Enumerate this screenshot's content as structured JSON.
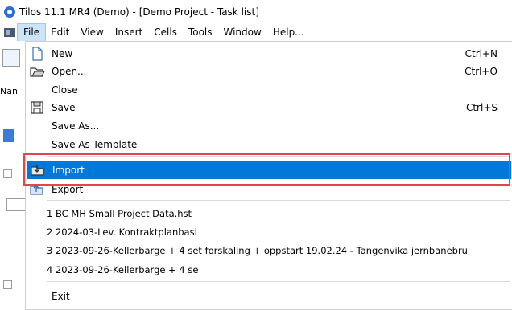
{
  "window": {
    "title": "Tilos 11.1 MR4  (Demo) - [Demo Project -  Task list]"
  },
  "menubar": {
    "items": [
      "File",
      "Edit",
      "View",
      "Insert",
      "Cells",
      "Tools",
      "Window",
      "Help..."
    ]
  },
  "background": {
    "partial_label": "Nan"
  },
  "file_menu": {
    "new": {
      "label": "New",
      "shortcut": "Ctrl+N"
    },
    "open": {
      "label": "Open...",
      "shortcut": "Ctrl+O"
    },
    "close": {
      "label": "Close"
    },
    "save": {
      "label": "Save",
      "shortcut": "Ctrl+S"
    },
    "save_as": {
      "label": "Save As..."
    },
    "save_as_template": {
      "label": "Save As Template"
    },
    "import": {
      "label": "Import"
    },
    "export": {
      "label": "Export"
    },
    "recent": [
      "1 BC MH Small Project Data.hst",
      "2 2024-03-Lev. Kontraktplanbasi",
      "3 2023-09-26-Kellerbarge + 4 set forskaling + oppstart 19.02.24 - Tangenvika jernbanebru",
      "4 2023-09-26-Kellerbarge + 4 se"
    ],
    "exit": {
      "label": "Exit"
    }
  },
  "colors": {
    "highlight": "#0078d7",
    "annotation_box": "#e0474c"
  }
}
